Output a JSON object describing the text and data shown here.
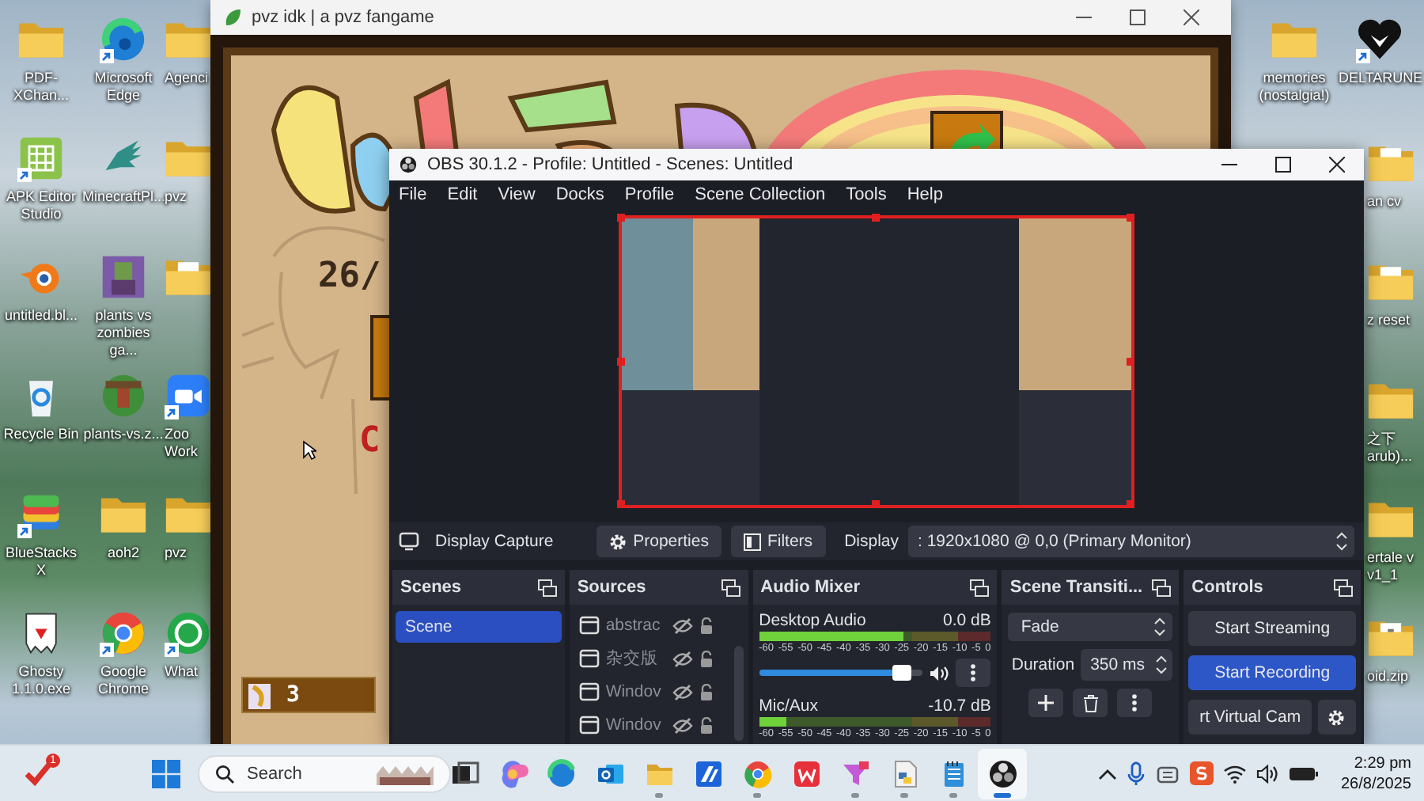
{
  "desktop": {
    "left_columns": [
      [
        {
          "label": "PDF-XChan...",
          "kind": "folder",
          "shortcut": false
        },
        {
          "label": "APK Editor Studio",
          "kind": "apk",
          "shortcut": true
        },
        {
          "label": "untitled.bl...",
          "kind": "blender",
          "shortcut": false
        },
        {
          "label": "Recycle Bin",
          "kind": "recycle",
          "shortcut": false
        },
        {
          "label": "BlueStacks X",
          "kind": "bluestacks",
          "shortcut": true
        },
        {
          "label": "Ghosty 1.1.0.exe",
          "kind": "ghost",
          "shortcut": false
        }
      ],
      [
        {
          "label": "Microsoft Edge",
          "kind": "edge",
          "shortcut": true
        },
        {
          "label": "MinecraftPl...",
          "kind": "minecraft",
          "shortcut": false
        },
        {
          "label": "plants vs zombies ga...",
          "kind": "game-art",
          "shortcut": false
        },
        {
          "label": "plants-vs.z...",
          "kind": "round-art",
          "shortcut": false
        },
        {
          "label": "aoh2",
          "kind": "folder",
          "shortcut": false
        },
        {
          "label": "Google Chrome",
          "kind": "chrome",
          "shortcut": true
        }
      ],
      [
        {
          "label": "Agenci",
          "kind": "folder",
          "shortcut": false
        },
        {
          "label": "pvz",
          "kind": "folder",
          "shortcut": false
        },
        {
          "kind": "file",
          "shortcut": false
        },
        {
          "label": "Zoo Work",
          "kind": "zoom",
          "shortcut": true
        },
        {
          "label": "pvz",
          "kind": "folder",
          "shortcut": false
        },
        {
          "label": "What",
          "kind": "whatsapp",
          "shortcut": true
        }
      ]
    ],
    "right_columns": [
      [
        {
          "label": "memories (nostalgia!)",
          "kind": "folder",
          "shortcut": false
        }
      ],
      [
        {
          "label": "DELTARUNE",
          "kind": "heart",
          "shortcut": true
        }
      ]
    ],
    "right_cut_items": [
      {
        "label": "an cv",
        "kind": "file"
      },
      {
        "label": "z reset",
        "kind": "file"
      },
      {
        "label": "之下 arub)...",
        "kind": "folder"
      },
      {
        "label": "ertale v v1_1",
        "kind": "folder"
      },
      {
        "label": "oid.zip",
        "kind": "zip"
      }
    ]
  },
  "game_window": {
    "title": "pvz idk | a pvz fangame",
    "date_text": "26/",
    "red_text": "C",
    "counter": "3"
  },
  "obs": {
    "title": "OBS 30.1.2 - Profile: Untitled - Scenes: Untitled",
    "menu": [
      "File",
      "Edit",
      "View",
      "Docks",
      "Profile",
      "Scene Collection",
      "Tools",
      "Help"
    ],
    "source_toolbar": {
      "source_name": "Display Capture",
      "buttons": [
        {
          "label": "Properties",
          "kind": "gear"
        },
        {
          "label": "Filters",
          "kind": "filter"
        }
      ],
      "display_label": "Display",
      "display_value": ": 1920x1080 @ 0,0 (Primary Monitor)"
    },
    "scenes": {
      "title": "Scenes",
      "items": [
        {
          "label": "Scene",
          "selected": true
        }
      ]
    },
    "sources": {
      "title": "Sources",
      "items": [
        {
          "label": "abstrac",
          "visible": false
        },
        {
          "label": "杂交版",
          "visible": false
        },
        {
          "label": "Windov",
          "visible": false
        },
        {
          "label": "Windov",
          "visible": false
        }
      ]
    },
    "audio_mixer": {
      "title": "Audio Mixer",
      "channels": [
        {
          "name": "Desktop Audio",
          "reading": "0.0 dB",
          "meter": {
            "level": 0.62
          },
          "scale": [
            "-60",
            "-55",
            "-50",
            "-45",
            "-40",
            "-35",
            "-30",
            "-25",
            "-20",
            "-15",
            "-10",
            "-5",
            "0"
          ],
          "slider": {
            "level": 0.93
          }
        },
        {
          "name": "Mic/Aux",
          "reading": "-10.7 dB",
          "meter": {
            "level": 0.12
          },
          "scale": [
            "-60",
            "-55",
            "-50",
            "-45",
            "-40",
            "-35",
            "-30",
            "-25",
            "-20",
            "-15",
            "-10",
            "-5",
            "0"
          ]
        }
      ]
    },
    "transitions": {
      "title": "Scene Transiti...",
      "transition": "Fade",
      "duration_label": "Duration",
      "duration": "350 ms"
    },
    "controls": {
      "title": "Controls",
      "buttons": [
        {
          "label": "Start Streaming",
          "highlighted": false
        },
        {
          "label": "Start Recording",
          "highlighted": true
        },
        {
          "label": "rt Virtual Cam",
          "highlighted": false
        }
      ]
    }
  },
  "taskbar": {
    "widget_badge": "1",
    "search_placeholder": "Search",
    "apps": [
      {
        "kind": "taskview",
        "running": false,
        "active": false
      },
      {
        "kind": "copilot",
        "running": false,
        "active": false
      },
      {
        "kind": "edge",
        "running": false,
        "active": false
      },
      {
        "kind": "outlook",
        "running": false,
        "active": false
      },
      {
        "kind": "explorer",
        "running": true,
        "active": false
      },
      {
        "kind": "docs",
        "running": false,
        "active": false
      },
      {
        "kind": "chrome",
        "running": true,
        "active": false
      },
      {
        "kind": "wps",
        "running": false,
        "active": false
      },
      {
        "kind": "funnel",
        "running": true,
        "active": false
      },
      {
        "kind": "python",
        "running": true,
        "active": false
      },
      {
        "kind": "notepad",
        "running": true,
        "active": false
      },
      {
        "kind": "obs",
        "running": true,
        "active": true
      }
    ],
    "time": "2:29 pm",
    "date": "26/8/2025"
  }
}
